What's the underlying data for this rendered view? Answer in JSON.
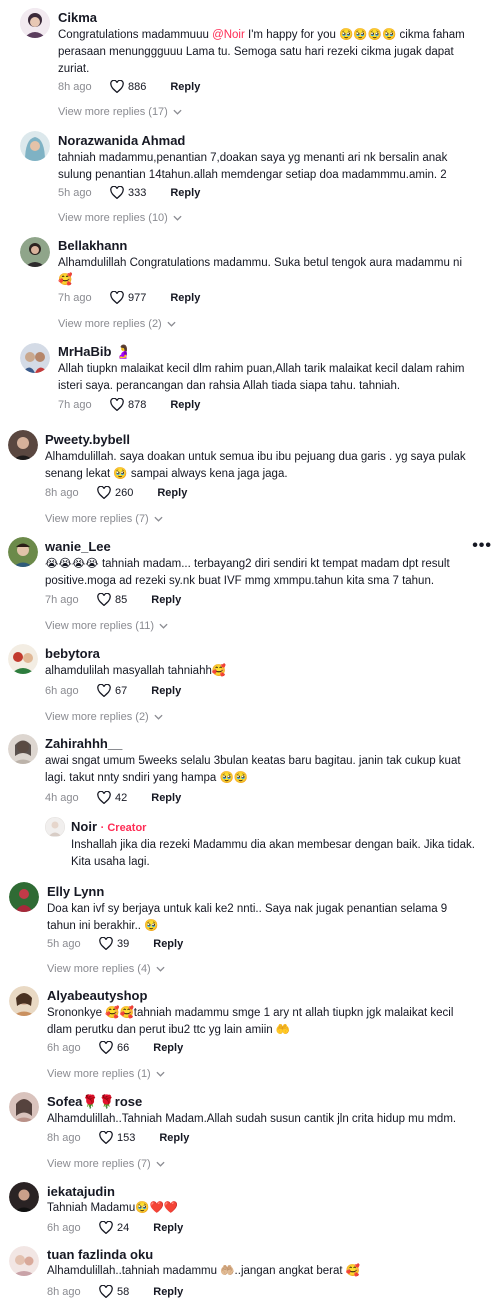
{
  "comments": [
    {
      "user": "Cikma",
      "text_pre": "Congratulations madammuuu ",
      "mention": "@Noir",
      "text": " I'm happy for you 🥹🥹🥹🥹 cikma faham perasaan menunggguuu Lama tu. Semoga satu hari rezeki cikma jugak dapat zuriat.",
      "time": "8h ago",
      "likes": "886",
      "reply": "Reply",
      "more": "View more replies (17)"
    },
    {
      "user": "Norazwanida Ahmad",
      "text": "tahniah madammu,penantian 7,doakan saya yg menanti ari nk bersalin anak sulung penantian 14tahun.allah memdengar setiap doa madammmu.amin. 2",
      "time": "5h ago",
      "likes": "333",
      "reply": "Reply",
      "more": "View more replies (10)"
    },
    {
      "user": "Bellakhann",
      "text": "Alhamdulillah Congratulations madammu. Suka betul tengok aura madammu ni 🥰",
      "time": "7h ago",
      "likes": "977",
      "reply": "Reply",
      "more": "View more replies (2)"
    },
    {
      "user": "MrHaBib 🤰",
      "text": "Allah tiupkn malaikat kecil dlm rahim puan,Allah tarik malaikat kecil dalam rahim isteri saya. perancangan dan rahsia Allah tiada siapa tahu. tahniah.",
      "time": "7h ago",
      "likes": "878",
      "reply": "Reply"
    },
    {
      "user": "Pweety.bybell",
      "text": "Alhamdulillah. saya doakan untuk semua ibu ibu pejuang dua garis . yg saya pulak senang lekat 🥹 sampai always kena jaga jaga.",
      "time": "8h ago",
      "likes": "260",
      "reply": "Reply",
      "more": "View more replies (7)"
    },
    {
      "user": "wanie_Lee",
      "text": "😭😭😭😭 tahniah madam... terbayang2 diri sendiri kt tempat madam dpt result positive.moga ad rezeki sy.nk buat IVF mmg xmmpu.tahun kita sma 7 tahun.",
      "time": "7h ago",
      "likes": "85",
      "reply": "Reply",
      "more": "View more replies (11)",
      "dots": "•••"
    },
    {
      "user": "bebytora",
      "text": "alhamdulilah masyallah tahniahh🥰",
      "time": "6h ago",
      "likes": "67",
      "reply": "Reply",
      "more": "View more replies (2)"
    },
    {
      "user": "Zahirahhh__",
      "text": "awai sngat umum 5weeks selalu 3bulan keatas baru bagitau. janin tak cukup kuat lagi. takut nnty sndiri yang hampa 🥹🥹",
      "time": "4h ago",
      "likes": "42",
      "reply": "Reply"
    },
    {
      "user": "Noir",
      "creator": "· Creator",
      "text": "Inshallah jika dia rezeki Madammu dia akan membesar dengan baik. Jika tidak. Kita usaha lagi."
    },
    {
      "user": "Elly Lynn",
      "text": "Doa kan ivf sy berjaya untuk kali ke2 nnti.. Saya nak jugak penantian selama 9 tahun ini berakhir.. 🥹",
      "time": "5h ago",
      "likes": "39",
      "reply": "Reply",
      "more": "View more replies (4)"
    },
    {
      "user": "Alyabeautyshop",
      "text": "Srononkye 🥰🥰tahniah madammu smge 1 ary nt allah tiupkn jgk malaikat kecil dlam perutku dan perut ibu2 ttc yg lain amiin 🤲",
      "time": "6h ago",
      "likes": "66",
      "reply": "Reply",
      "more": "View more replies (1)"
    },
    {
      "user": "Sofea🌹🌹rose",
      "text": "Alhamdulillah..Tahniah Madam.Allah sudah susun cantik jln crita hidup mu mdm.",
      "time": "8h ago",
      "likes": "153",
      "reply": "Reply",
      "more": "View more replies (7)"
    },
    {
      "user": "iekatajudin",
      "text": "Tahniah Madamu🥹❤️❤️",
      "time": "6h ago",
      "likes": "24",
      "reply": "Reply"
    },
    {
      "user": "tuan fazlinda oku",
      "text": "Alhamdulillah..tahniah madammu 🤲🏼..jangan angkat berat 🥰",
      "time": "8h ago",
      "likes": "58",
      "reply": "Reply"
    }
  ],
  "colors": {
    "accent": "#fe2c55",
    "muted": "#8a8b91",
    "text": "#161823"
  },
  "icons": {
    "like": "heart-outline-icon",
    "more": "chevron-down-icon",
    "options": "more-horizontal-icon"
  }
}
